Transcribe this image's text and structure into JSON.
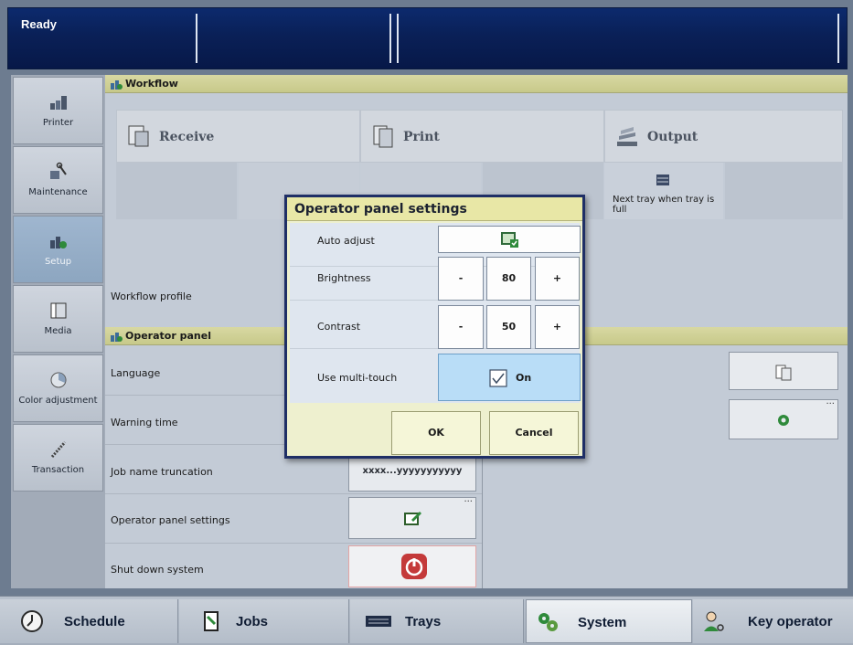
{
  "status": {
    "text": "Ready"
  },
  "sidebar": {
    "items": [
      {
        "label": "Printer",
        "icon": "printer-icon"
      },
      {
        "label": "Maintenance",
        "icon": "maintenance-icon"
      },
      {
        "label": "Setup",
        "icon": "setup-icon",
        "active": true
      },
      {
        "label": "Media",
        "icon": "media-icon"
      },
      {
        "label": "Color adjustment",
        "icon": "color-adjustment-icon"
      },
      {
        "label": "Transaction",
        "icon": "transaction-icon"
      }
    ]
  },
  "workflow": {
    "title": "Workflow",
    "columns": [
      {
        "label": "Receive",
        "icon": "receive-icon"
      },
      {
        "label": "Print",
        "icon": "print-icon"
      },
      {
        "label": "Output",
        "icon": "output-icon"
      }
    ],
    "output_note": "Next tray when tray is full",
    "profile_label": "Workflow profile"
  },
  "operator_panel": {
    "title": "Operator panel",
    "rows": [
      {
        "label": "Language"
      },
      {
        "label": "Warning time"
      },
      {
        "label": "Job name truncation",
        "value": "xxxx...yyyyyyyyyyy"
      },
      {
        "label": "Operator panel settings"
      },
      {
        "label": "Shut down system"
      }
    ],
    "right_more": "..."
  },
  "dialog": {
    "title": "Operator panel settings",
    "rows": {
      "auto_adjust": {
        "label": "Auto adjust"
      },
      "brightness": {
        "label": "Brightness",
        "value": "80",
        "minus": "-",
        "plus": "+"
      },
      "contrast": {
        "label": "Contrast",
        "value": "50",
        "minus": "-",
        "plus": "+"
      },
      "multitouch": {
        "label": "Use multi-touch",
        "state": "On"
      }
    },
    "ok_label": "OK",
    "cancel_label": "Cancel"
  },
  "tabs": [
    {
      "label": "Schedule",
      "icon": "clock-icon"
    },
    {
      "label": "Jobs",
      "icon": "jobs-icon"
    },
    {
      "label": "Trays",
      "icon": "trays-icon"
    },
    {
      "label": "System",
      "icon": "system-gears-icon",
      "active": true
    },
    {
      "label": "Key operator",
      "icon": "key-operator-icon"
    }
  ],
  "more_dots": "..."
}
